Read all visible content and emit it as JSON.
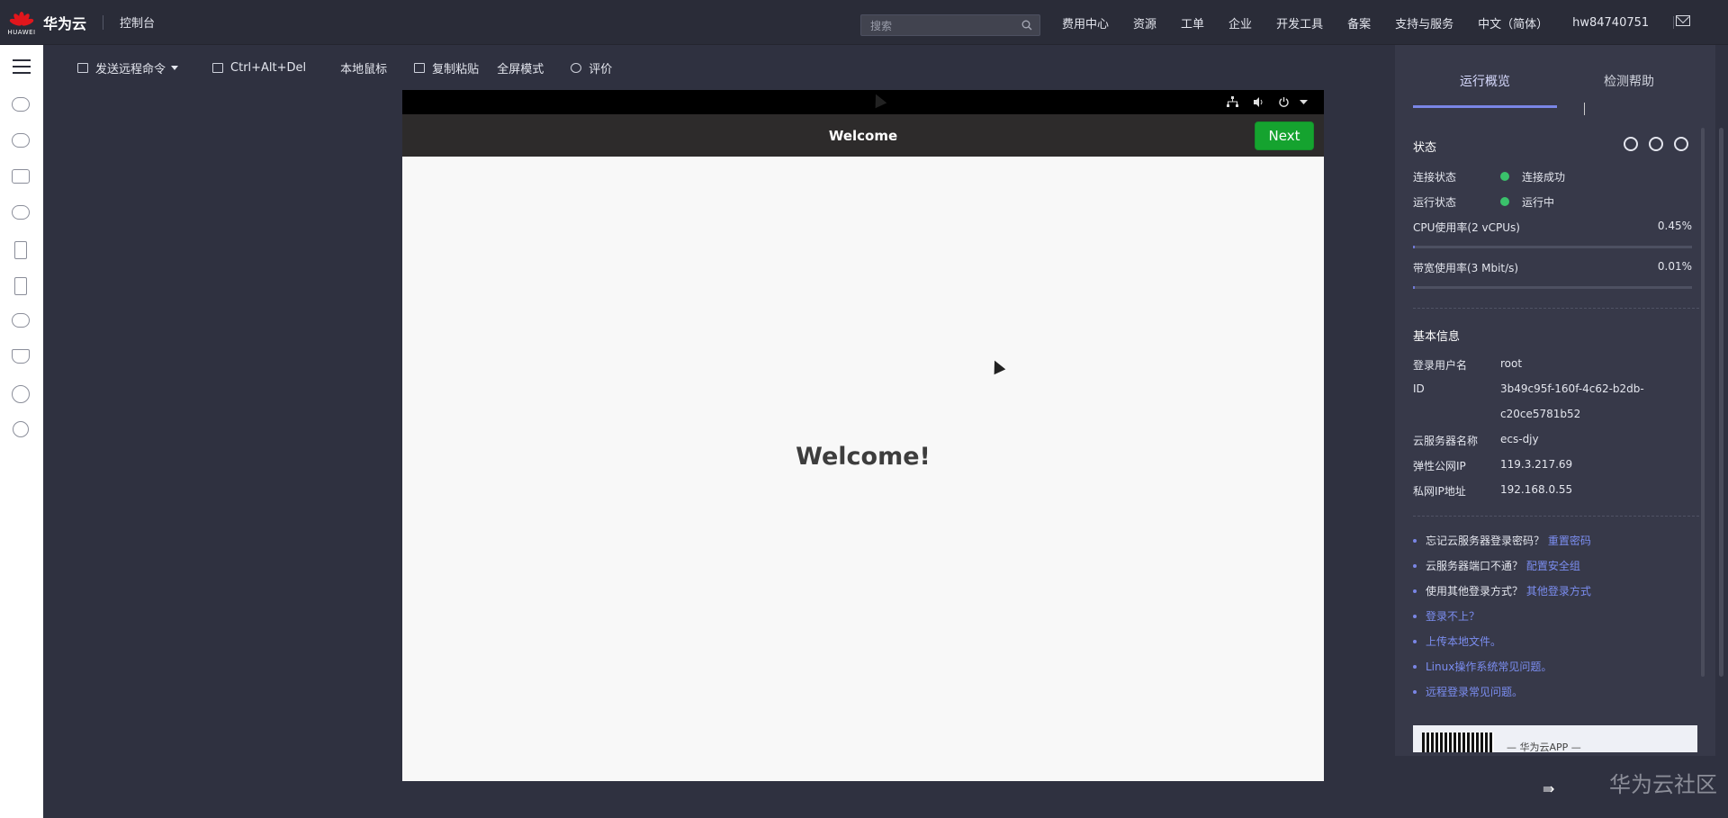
{
  "header": {
    "logo_text": "HUAWEI",
    "brand": "华为云",
    "console": "控制台",
    "search_placeholder": "搜索",
    "nav": [
      "费用中心",
      "资源",
      "工单",
      "企业",
      "开发工具",
      "备案",
      "支持与服务",
      "中文（简体）",
      "hw84740751"
    ]
  },
  "toolbar": {
    "send_cmd": "发送远程命令",
    "ctrl_alt_del": "Ctrl+Alt+Del",
    "local_mouse": "本地鼠标",
    "copy_paste": "复制粘贴",
    "fullscreen": "全屏模式",
    "rate": "评价"
  },
  "vm": {
    "header_title": "Welcome",
    "next_label": "Next",
    "welcome_text": "Welcome!"
  },
  "panel": {
    "tab_overview": "运行概览",
    "tab_help": "检测帮助",
    "status_title": "状态",
    "conn_label": "连接状态",
    "conn_value": "连接成功",
    "run_label": "运行状态",
    "run_value": "运行中",
    "cpu_label": "CPU使用率(2 vCPUs)",
    "cpu_value": "0.45%",
    "cpu_fraction": 0.0045,
    "bw_label": "带宽使用率(3 Mbit/s)",
    "bw_value": "0.01%",
    "bw_fraction": 0.0001,
    "basic_title": "基本信息",
    "user_label": "登录用户名",
    "user_value": "root",
    "id_label": "ID",
    "id_value_1": "3b49c95f-160f-4c62-b2db-",
    "id_value_2": "c20ce5781b52",
    "name_label": "云服务器名称",
    "name_value": "ecs-djy",
    "eip_label": "弹性公网IP",
    "eip_value": "119.3.217.69",
    "pip_label": "私网IP地址",
    "pip_value": "192.168.0.55",
    "help1": "忘记云服务器登录密码？",
    "help1_link": "重置密码",
    "help2": "云服务器端口不通？",
    "help2_link": "配置安全组",
    "help3": "使用其他登录方式？",
    "help3_link": "其他登录方式",
    "link4": "登录不上？",
    "link5": "上传本地文件。",
    "link6": "Linux操作系统常见问题。",
    "link7": "远程登录常见问题。",
    "qr_text": "— 华为云APP —",
    "watermark": "华为云社区"
  },
  "colors": {
    "accent": "#7a86e6",
    "next_green": "#15a32f",
    "status_green": "#3ac16b",
    "brand_red": "#e1161c"
  }
}
